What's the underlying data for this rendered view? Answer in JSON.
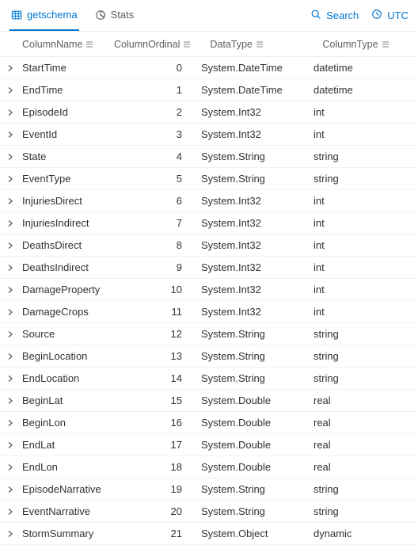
{
  "tabs": {
    "getschema": "getschema",
    "stats": "Stats"
  },
  "toolbar": {
    "search": "Search",
    "tz": "UTC"
  },
  "columns": {
    "name": "ColumnName",
    "ordinal": "ColumnOrdinal",
    "datatype": "DataType",
    "coltype": "ColumnType"
  },
  "rows": [
    {
      "name": "StartTime",
      "ordinal": 0,
      "datatype": "System.DateTime",
      "coltype": "datetime"
    },
    {
      "name": "EndTime",
      "ordinal": 1,
      "datatype": "System.DateTime",
      "coltype": "datetime"
    },
    {
      "name": "EpisodeId",
      "ordinal": 2,
      "datatype": "System.Int32",
      "coltype": "int"
    },
    {
      "name": "EventId",
      "ordinal": 3,
      "datatype": "System.Int32",
      "coltype": "int"
    },
    {
      "name": "State",
      "ordinal": 4,
      "datatype": "System.String",
      "coltype": "string"
    },
    {
      "name": "EventType",
      "ordinal": 5,
      "datatype": "System.String",
      "coltype": "string"
    },
    {
      "name": "InjuriesDirect",
      "ordinal": 6,
      "datatype": "System.Int32",
      "coltype": "int"
    },
    {
      "name": "InjuriesIndirect",
      "ordinal": 7,
      "datatype": "System.Int32",
      "coltype": "int"
    },
    {
      "name": "DeathsDirect",
      "ordinal": 8,
      "datatype": "System.Int32",
      "coltype": "int"
    },
    {
      "name": "DeathsIndirect",
      "ordinal": 9,
      "datatype": "System.Int32",
      "coltype": "int"
    },
    {
      "name": "DamageProperty",
      "ordinal": 10,
      "datatype": "System.Int32",
      "coltype": "int"
    },
    {
      "name": "DamageCrops",
      "ordinal": 11,
      "datatype": "System.Int32",
      "coltype": "int"
    },
    {
      "name": "Source",
      "ordinal": 12,
      "datatype": "System.String",
      "coltype": "string"
    },
    {
      "name": "BeginLocation",
      "ordinal": 13,
      "datatype": "System.String",
      "coltype": "string"
    },
    {
      "name": "EndLocation",
      "ordinal": 14,
      "datatype": "System.String",
      "coltype": "string"
    },
    {
      "name": "BeginLat",
      "ordinal": 15,
      "datatype": "System.Double",
      "coltype": "real"
    },
    {
      "name": "BeginLon",
      "ordinal": 16,
      "datatype": "System.Double",
      "coltype": "real"
    },
    {
      "name": "EndLat",
      "ordinal": 17,
      "datatype": "System.Double",
      "coltype": "real"
    },
    {
      "name": "EndLon",
      "ordinal": 18,
      "datatype": "System.Double",
      "coltype": "real"
    },
    {
      "name": "EpisodeNarrative",
      "ordinal": 19,
      "datatype": "System.String",
      "coltype": "string"
    },
    {
      "name": "EventNarrative",
      "ordinal": 20,
      "datatype": "System.String",
      "coltype": "string"
    },
    {
      "name": "StormSummary",
      "ordinal": 21,
      "datatype": "System.Object",
      "coltype": "dynamic"
    }
  ]
}
